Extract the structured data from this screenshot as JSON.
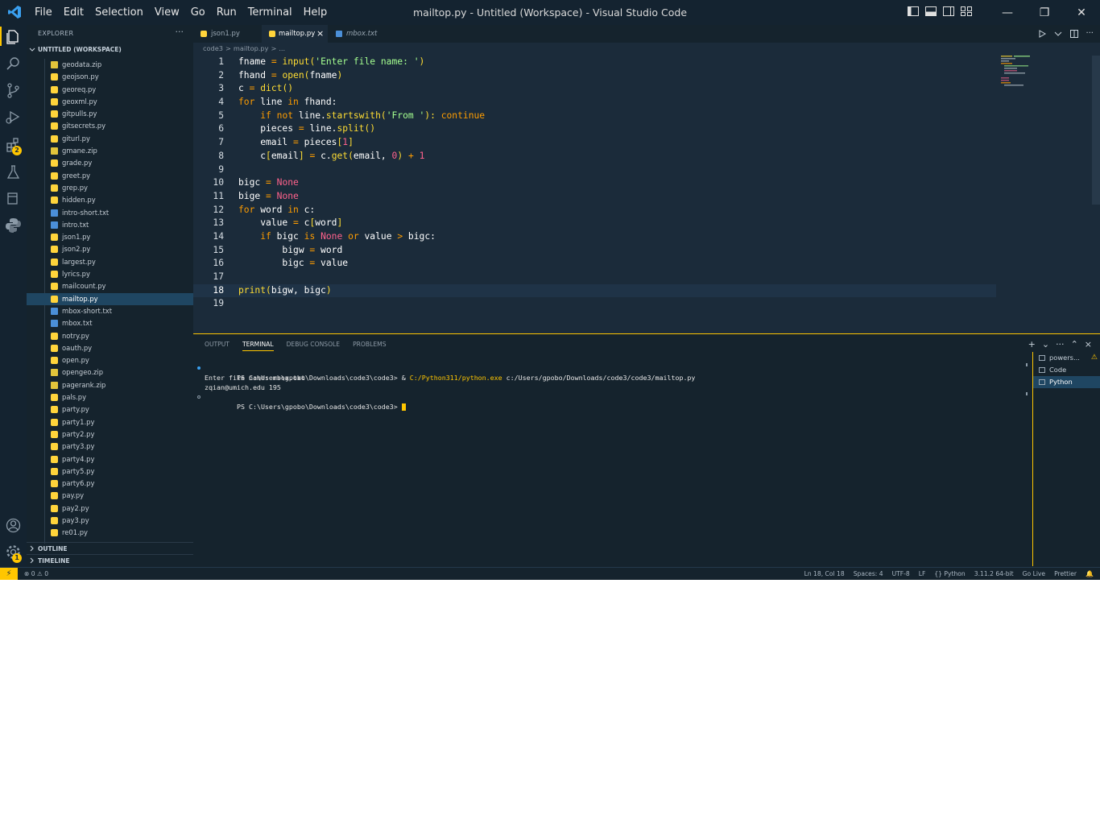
{
  "window": {
    "title": "mailtop.py - Untitled (Workspace) - Visual Studio Code"
  },
  "menu": [
    "File",
    "Edit",
    "Selection",
    "View",
    "Go",
    "Run",
    "Terminal",
    "Help"
  ],
  "activity_bar": {
    "items": [
      "explorer-icon",
      "search-icon",
      "source-control-icon",
      "run-debug-icon",
      "extensions-icon",
      "testing-icon",
      "remote-explorer-icon",
      "python-icon"
    ],
    "extensions_badge": "2",
    "settings_badge": "1"
  },
  "sidebar": {
    "title": "EXPLORER",
    "more": "···",
    "workspace": "UNTITLED (WORKSPACE)",
    "files": [
      {
        "name": "geodata.zip",
        "type": "zip"
      },
      {
        "name": "geojson.py",
        "type": "py"
      },
      {
        "name": "georeq.py",
        "type": "py"
      },
      {
        "name": "geoxml.py",
        "type": "py"
      },
      {
        "name": "gitpulls.py",
        "type": "py"
      },
      {
        "name": "gitsecrets.py",
        "type": "py"
      },
      {
        "name": "giturl.py",
        "type": "py"
      },
      {
        "name": "gmane.zip",
        "type": "zip"
      },
      {
        "name": "grade.py",
        "type": "py"
      },
      {
        "name": "greet.py",
        "type": "py"
      },
      {
        "name": "grep.py",
        "type": "py"
      },
      {
        "name": "hidden.py",
        "type": "py"
      },
      {
        "name": "intro-short.txt",
        "type": "txt"
      },
      {
        "name": "intro.txt",
        "type": "txt"
      },
      {
        "name": "json1.py",
        "type": "py"
      },
      {
        "name": "json2.py",
        "type": "py"
      },
      {
        "name": "largest.py",
        "type": "py"
      },
      {
        "name": "lyrics.py",
        "type": "py"
      },
      {
        "name": "mailcount.py",
        "type": "py"
      },
      {
        "name": "mailtop.py",
        "type": "py",
        "active": true
      },
      {
        "name": "mbox-short.txt",
        "type": "txt"
      },
      {
        "name": "mbox.txt",
        "type": "txt"
      },
      {
        "name": "notry.py",
        "type": "py"
      },
      {
        "name": "oauth.py",
        "type": "py"
      },
      {
        "name": "open.py",
        "type": "py"
      },
      {
        "name": "opengeo.zip",
        "type": "zip"
      },
      {
        "name": "pagerank.zip",
        "type": "zip"
      },
      {
        "name": "pals.py",
        "type": "py"
      },
      {
        "name": "party.py",
        "type": "py"
      },
      {
        "name": "party1.py",
        "type": "py"
      },
      {
        "name": "party2.py",
        "type": "py"
      },
      {
        "name": "party3.py",
        "type": "py"
      },
      {
        "name": "party4.py",
        "type": "py"
      },
      {
        "name": "party5.py",
        "type": "py"
      },
      {
        "name": "party6.py",
        "type": "py"
      },
      {
        "name": "pay.py",
        "type": "py"
      },
      {
        "name": "pay2.py",
        "type": "py"
      },
      {
        "name": "pay3.py",
        "type": "py"
      },
      {
        "name": "re01.py",
        "type": "py"
      }
    ],
    "outline": "OUTLINE",
    "timeline": "TIMELINE"
  },
  "tabs": [
    {
      "label": "json1.py",
      "active": false,
      "italic": false
    },
    {
      "label": "mailtop.py",
      "active": true,
      "italic": false,
      "close": "×"
    },
    {
      "label": "mbox.txt",
      "active": false,
      "italic": true
    }
  ],
  "breadcrumb": [
    "code3",
    ">",
    "mailtop.py",
    ">",
    "..."
  ],
  "code": {
    "current_line": 18,
    "lines": [
      [
        [
          "fname ",
          ""
        ],
        [
          "=",
          "op"
        ],
        [
          " ",
          ""
        ],
        [
          "input",
          "fn"
        ],
        [
          "(",
          "br"
        ],
        [
          "'Enter file name: '",
          "st"
        ],
        [
          ")",
          "br"
        ]
      ],
      [
        [
          "fhand ",
          ""
        ],
        [
          "=",
          "op"
        ],
        [
          " ",
          ""
        ],
        [
          "open",
          "fn"
        ],
        [
          "(",
          "br"
        ],
        [
          "fname",
          ""
        ],
        [
          ")",
          "br"
        ]
      ],
      [
        [
          "c ",
          ""
        ],
        [
          "=",
          "op"
        ],
        [
          " ",
          ""
        ],
        [
          "dict",
          "fn"
        ],
        [
          "()",
          "br"
        ]
      ],
      [
        [
          "for",
          "kw"
        ],
        [
          " line ",
          ""
        ],
        [
          "in",
          "kw"
        ],
        [
          " fhand:",
          ""
        ]
      ],
      [
        [
          "    ",
          ""
        ],
        [
          "if",
          "kw"
        ],
        [
          " ",
          ""
        ],
        [
          "not",
          "kw"
        ],
        [
          " line.",
          ""
        ],
        [
          "startswith",
          "fn"
        ],
        [
          "(",
          "br"
        ],
        [
          "'From '",
          "st"
        ],
        [
          "): ",
          "br"
        ],
        [
          "continue",
          "kw"
        ]
      ],
      [
        [
          "    pieces ",
          ""
        ],
        [
          "=",
          "op"
        ],
        [
          " line.",
          ""
        ],
        [
          "split",
          "fn"
        ],
        [
          "()",
          "br"
        ]
      ],
      [
        [
          "    email ",
          ""
        ],
        [
          "=",
          "op"
        ],
        [
          " pieces",
          ""
        ],
        [
          "[",
          "br"
        ],
        [
          "1",
          "nb"
        ],
        [
          "]",
          "br"
        ]
      ],
      [
        [
          "    c",
          ""
        ],
        [
          "[",
          "br"
        ],
        [
          "email",
          ""
        ],
        [
          "]",
          "br"
        ],
        [
          " ",
          ""
        ],
        [
          "=",
          "op"
        ],
        [
          " c.",
          ""
        ],
        [
          "get",
          "fn"
        ],
        [
          "(",
          "br"
        ],
        [
          "email, ",
          ""
        ],
        [
          "0",
          "nb"
        ],
        [
          ")",
          "br"
        ],
        [
          " ",
          ""
        ],
        [
          "+",
          "op"
        ],
        [
          " ",
          ""
        ],
        [
          "1",
          "nb"
        ]
      ],
      [],
      [
        [
          "bigc ",
          ""
        ],
        [
          "=",
          "op"
        ],
        [
          " ",
          ""
        ],
        [
          "None",
          "nb"
        ]
      ],
      [
        [
          "bige ",
          ""
        ],
        [
          "=",
          "op"
        ],
        [
          " ",
          ""
        ],
        [
          "None",
          "nb"
        ]
      ],
      [
        [
          "for",
          "kw"
        ],
        [
          " word ",
          ""
        ],
        [
          "in",
          "kw"
        ],
        [
          " c:",
          ""
        ]
      ],
      [
        [
          "    value ",
          ""
        ],
        [
          "=",
          "op"
        ],
        [
          " c",
          ""
        ],
        [
          "[",
          "br"
        ],
        [
          "word",
          ""
        ],
        [
          "]",
          "br"
        ]
      ],
      [
        [
          "    ",
          ""
        ],
        [
          "if",
          "kw"
        ],
        [
          " bigc ",
          ""
        ],
        [
          "is",
          "kw"
        ],
        [
          " ",
          ""
        ],
        [
          "None",
          "nb"
        ],
        [
          " ",
          ""
        ],
        [
          "or",
          "kw"
        ],
        [
          " value ",
          ""
        ],
        [
          ">",
          "op"
        ],
        [
          " bigc:",
          ""
        ]
      ],
      [
        [
          "        bigw ",
          ""
        ],
        [
          "=",
          "op"
        ],
        [
          " word",
          ""
        ]
      ],
      [
        [
          "        bigc ",
          ""
        ],
        [
          "=",
          "op"
        ],
        [
          " value",
          ""
        ]
      ],
      [],
      [
        [
          "print",
          "fn"
        ],
        [
          "(",
          "br"
        ],
        [
          "bigw, bigc",
          ""
        ],
        [
          ")",
          "br"
        ]
      ],
      []
    ]
  },
  "panel": {
    "tabs": [
      {
        "label": "OUTPUT",
        "active": false
      },
      {
        "label": "TERMINAL",
        "active": true
      },
      {
        "label": "DEBUG CONSOLE",
        "active": false
      },
      {
        "label": "PROBLEMS",
        "active": false
      }
    ],
    "actions": [
      "+",
      "⌄",
      "···",
      "⌃",
      "×"
    ],
    "terminal": {
      "cmd_prompt": "PS C:\\Users\\gpobo\\Downloads\\code3\\code3> & ",
      "cmd_exe": "C:/Python311/python.exe",
      "cmd_arg": " c:/Users/gpobo/Downloads/code3/code3/mailtop.py",
      "output1": "Enter file name: mbox.txt",
      "output2": "zqian@umich.edu 195",
      "prompt": "PS C:\\Users\\gpobo\\Downloads\\code3\\code3> "
    },
    "terminal_list": [
      {
        "label": "powers...",
        "warning": "⚠"
      },
      {
        "label": "Code"
      },
      {
        "label": "Python",
        "active": true
      }
    ]
  },
  "status": {
    "remote": "⚡",
    "errors": "⊗ 0",
    "warnings": "⚠ 0",
    "right": [
      "Ln 18, Col 18",
      "Spaces: 4",
      "UTF-8",
      "LF",
      "{} Python",
      "3.11.2 64-bit",
      "Go Live",
      "Prettier"
    ]
  },
  "colors": {
    "accent": "#ffc600",
    "background": "#1b2b3a",
    "sidebar": "#15232d",
    "keyword": "#ff9d00",
    "function": "#ffdd33",
    "string": "#a5ff90",
    "number": "#ff628c"
  }
}
